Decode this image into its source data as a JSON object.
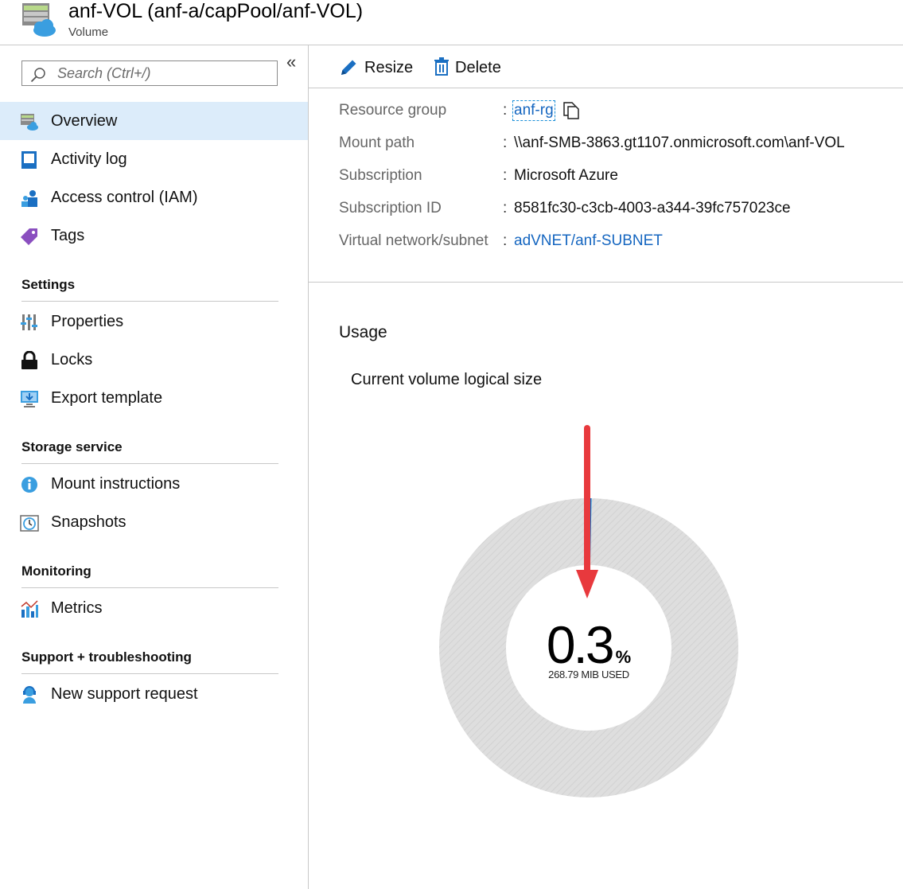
{
  "header": {
    "title": "anf-VOL (anf-a/capPool/anf-VOL)",
    "subtitle": "Volume"
  },
  "sidebar": {
    "search_placeholder": "Search (Ctrl+/)",
    "collapse_glyph": "«",
    "top_items": [
      {
        "label": "Overview",
        "icon": "volume-icon",
        "selected": true
      },
      {
        "label": "Activity log",
        "icon": "activity-log-icon"
      },
      {
        "label": "Access control (IAM)",
        "icon": "iam-icon"
      },
      {
        "label": "Tags",
        "icon": "tag-icon"
      }
    ],
    "sections": [
      {
        "title": "Settings",
        "items": [
          {
            "label": "Properties",
            "icon": "properties-icon"
          },
          {
            "label": "Locks",
            "icon": "lock-icon"
          },
          {
            "label": "Export template",
            "icon": "export-template-icon"
          }
        ]
      },
      {
        "title": "Storage service",
        "items": [
          {
            "label": "Mount instructions",
            "icon": "info-icon"
          },
          {
            "label": "Snapshots",
            "icon": "snapshot-icon"
          }
        ]
      },
      {
        "title": "Monitoring",
        "items": [
          {
            "label": "Metrics",
            "icon": "metrics-icon"
          }
        ]
      },
      {
        "title": "Support + troubleshooting",
        "items": [
          {
            "label": "New support request",
            "icon": "support-icon"
          }
        ]
      }
    ]
  },
  "toolbar": {
    "resize_label": "Resize",
    "delete_label": "Delete"
  },
  "essentials": [
    {
      "label": "Resource group",
      "value": "anf-rg",
      "link": true
    },
    {
      "label": "Mount path",
      "value": "\\\\anf-SMB-3863.gt1107.onmicrosoft.com\\anf-VOL",
      "link": false
    },
    {
      "label": "Subscription",
      "value": "Microsoft Azure",
      "link": false
    },
    {
      "label": "Subscription ID",
      "value": "8581fc30-c3cb-4003-a344-39fc757023ce",
      "link": false
    },
    {
      "label": "Virtual network/subnet",
      "value": "adVNET/anf-SUBNET",
      "link": true
    }
  ],
  "colon": ":",
  "usage": {
    "title": "Usage",
    "subtitle": "Current volume logical size",
    "percent": "0.3",
    "percent_symbol": "%",
    "used_text": "268.79 MIB USED",
    "used_fraction": 0.003
  },
  "colors": {
    "accent": "#0078d4",
    "link": "#1566c0",
    "selected_bg": "#dcecfa",
    "donut": "#dcdcdc",
    "arrow": "#e8393d"
  }
}
